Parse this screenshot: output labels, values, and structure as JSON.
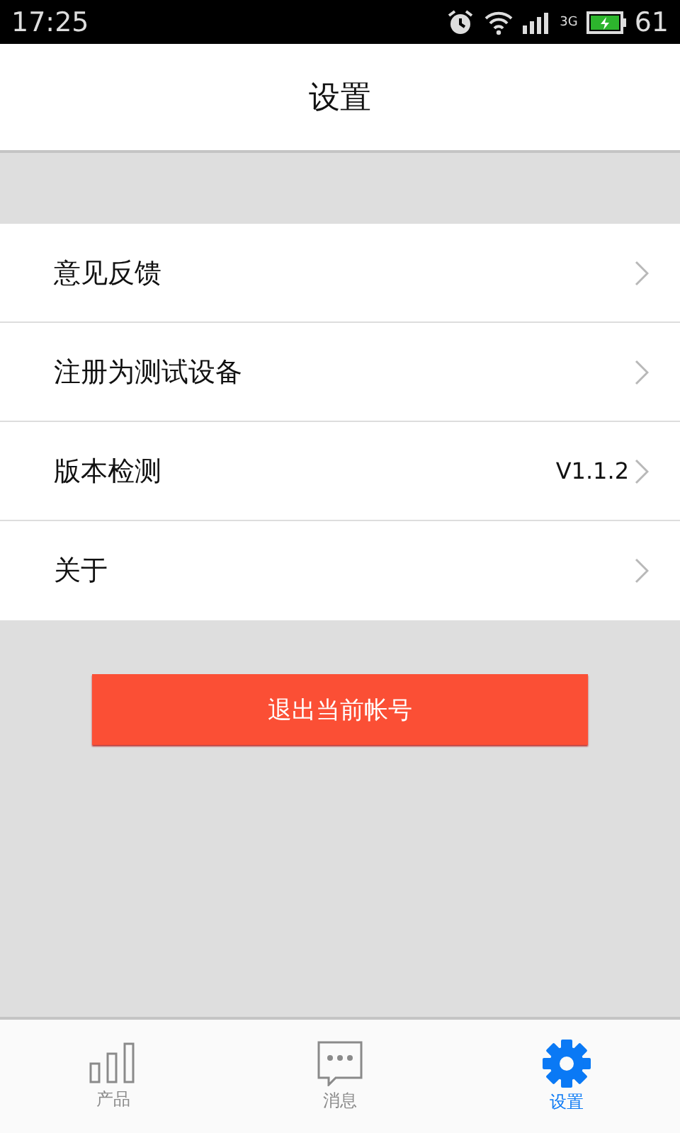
{
  "status_bar": {
    "time": "17:25",
    "network": "3G",
    "battery": "61"
  },
  "header": {
    "title": "设置"
  },
  "settings": [
    {
      "label": "意见反馈"
    },
    {
      "label": "注册为测试设备"
    },
    {
      "label": "版本检测",
      "value": "V1.1.2"
    },
    {
      "label": "关于"
    }
  ],
  "logout_button": "退出当前帐号",
  "tabs": [
    {
      "label": "产品",
      "kind": "bars",
      "selected": false
    },
    {
      "label": "消息",
      "kind": "chat",
      "selected": false
    },
    {
      "label": "设置",
      "kind": "gear",
      "selected": true
    }
  ]
}
